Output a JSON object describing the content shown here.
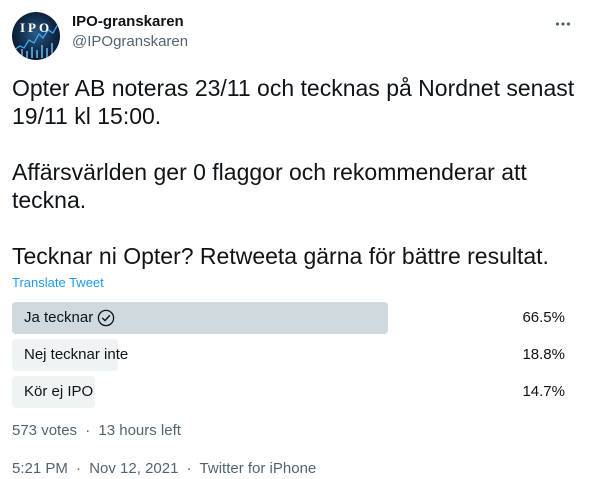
{
  "author": {
    "display_name": "IPO-granskaren",
    "handle": "@IPOgranskaren",
    "avatar_text": "IPO"
  },
  "tweet": {
    "text": "Opter AB noteras 23/11 och tecknas på Nordnet senast 19/11 kl 15:00.\n\nAffärsvärlden ger 0 flaggor och rekommenderar att teckna.\n\nTecknar ni Opter? Retweeta gärna för bättre resultat.",
    "translate_label": "Translate Tweet"
  },
  "poll": {
    "options": [
      {
        "label": "Ja tecknar",
        "percent": "66.5%",
        "fraction": 0.665,
        "winner": true
      },
      {
        "label": "Nej tecknar inte",
        "percent": "18.8%",
        "fraction": 0.188,
        "winner": false
      },
      {
        "label": "Kör ej IPO",
        "percent": "14.7%",
        "fraction": 0.147,
        "winner": false
      }
    ],
    "votes": "573 votes",
    "time_left": "13 hours left",
    "colors": {
      "winner_bar": "#cfd9de",
      "other_bar": "#eff3f4"
    }
  },
  "meta": {
    "time": "5:21 PM",
    "date": "Nov 12, 2021",
    "source": "Twitter for iPhone"
  },
  "icons": {
    "more": "more-horizontal-icon",
    "check": "check-circle-icon"
  },
  "colors": {
    "accent": "#1d9bf0",
    "text": "#0f1419",
    "secondary": "#536471"
  }
}
